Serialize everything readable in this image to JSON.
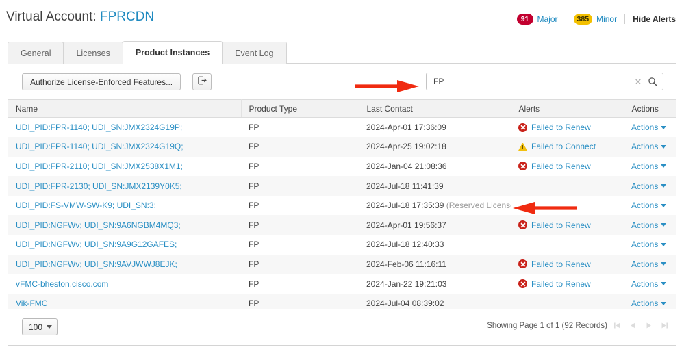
{
  "header": {
    "title_prefix": "Virtual Account:",
    "account_name": "FPRCDN",
    "alerts": {
      "major_count": "91",
      "major_label": "Major",
      "minor_count": "385",
      "minor_label": "Minor",
      "hide_alerts_label": "Hide Alerts",
      "major_color": "#c2002f",
      "minor_color": "#f3c000",
      "link_color": "#1f8ac0"
    }
  },
  "tabs": [
    {
      "label": "General",
      "active": false
    },
    {
      "label": "Licenses",
      "active": false
    },
    {
      "label": "Product Instances",
      "active": true
    },
    {
      "label": "Event Log",
      "active": false
    }
  ],
  "toolbar": {
    "authorize_label": "Authorize License-Enforced Features...",
    "export_icon": "export-icon",
    "search": {
      "value": "FP",
      "placeholder": "",
      "clear_icon": "close-icon",
      "search_icon": "search-icon"
    }
  },
  "table": {
    "columns": [
      "Name",
      "Product Type",
      "Last Contact",
      "Alerts",
      "Actions"
    ],
    "actions_label": "Actions",
    "rows": [
      {
        "name": "UDI_PID:FPR-1140; UDI_SN:JMX2324G19P;",
        "product_type": "FP",
        "last_contact": "2024-Apr-01 17:36:09",
        "last_contact_note": "",
        "alert": "Failed to Renew",
        "alert_icon": "error-icon"
      },
      {
        "name": "UDI_PID:FPR-1140; UDI_SN:JMX2324G19Q;",
        "product_type": "FP",
        "last_contact": "2024-Apr-25 19:02:18",
        "last_contact_note": "",
        "alert": "Failed to Connect",
        "alert_icon": "warning-icon"
      },
      {
        "name": "UDI_PID:FPR-2110; UDI_SN:JMX2538X1M1;",
        "product_type": "FP",
        "last_contact": "2024-Jan-04 21:08:36",
        "last_contact_note": "",
        "alert": "Failed to Renew",
        "alert_icon": "error-icon"
      },
      {
        "name": "UDI_PID:FPR-2130; UDI_SN:JMX2139Y0K5;",
        "product_type": "FP",
        "last_contact": "2024-Jul-18 11:41:39",
        "last_contact_note": "",
        "alert": "",
        "alert_icon": ""
      },
      {
        "name": "UDI_PID:FS-VMW-SW-K9; UDI_SN:3;",
        "product_type": "FP",
        "last_contact": "2024-Jul-18 17:35:39",
        "last_contact_note": "(Reserved Licenses)",
        "alert": "",
        "alert_icon": ""
      },
      {
        "name": "UDI_PID:NGFWv; UDI_SN:9A6NGBM4MQ3;",
        "product_type": "FP",
        "last_contact": "2024-Apr-01 19:56:37",
        "last_contact_note": "",
        "alert": "Failed to Renew",
        "alert_icon": "error-icon"
      },
      {
        "name": "UDI_PID:NGFWv; UDI_SN:9A9G12GAFES;",
        "product_type": "FP",
        "last_contact": "2024-Jul-18 12:40:33",
        "last_contact_note": "",
        "alert": "",
        "alert_icon": ""
      },
      {
        "name": "UDI_PID:NGFWv; UDI_SN:9AVJWWJ8EJK;",
        "product_type": "FP",
        "last_contact": "2024-Feb-06 11:16:11",
        "last_contact_note": "",
        "alert": "Failed to Renew",
        "alert_icon": "error-icon"
      },
      {
        "name": "vFMC-bheston.cisco.com",
        "product_type": "FP",
        "last_contact": "2024-Jan-22 19:21:03",
        "last_contact_note": "",
        "alert": "Failed to Renew",
        "alert_icon": "error-icon"
      },
      {
        "name": "Vik-FMC",
        "product_type": "FP",
        "last_contact": "2024-Jul-04 08:39:02",
        "last_contact_note": "",
        "alert": "",
        "alert_icon": ""
      }
    ]
  },
  "footer": {
    "page_size": "100",
    "page_info": "Showing Page 1 of 1 (92 Records)",
    "nav": [
      "first-page-icon",
      "previous-page-icon",
      "next-page-icon",
      "last-page-icon"
    ]
  },
  "annotations": {
    "arrow_color": "#f02b10",
    "arrow_right": "arrow-pointing-at-search-box",
    "arrow_left": "arrow-pointing-at-reserved-licenses"
  }
}
